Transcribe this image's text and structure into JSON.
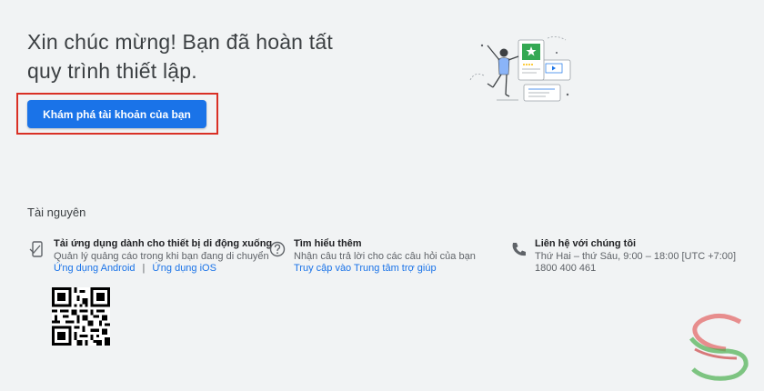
{
  "header": {
    "headline": "Xin chúc mừng! Bạn đã hoàn tất quy trình thiết lập.",
    "explore_button": "Khám phá tài khoản của bạn"
  },
  "resources": {
    "title": "Tài nguyên",
    "mobile": {
      "icon": "mobile-phone-icon",
      "title": "Tải ứng dụng dành cho thiết bị di động xuống",
      "description": "Quản lý quảng cáo trong khi bạn đang di chuyển",
      "android_link": "Ứng dụng Android",
      "separator": "|",
      "ios_link": "Ứng dụng iOS"
    },
    "learn": {
      "icon": "help-circle-icon",
      "title": "Tìm hiểu thêm",
      "description": "Nhận câu trả lời cho các câu hỏi của bạn",
      "help_link": "Truy cập vào Trung tâm trợ giúp"
    },
    "contact": {
      "icon": "phone-icon",
      "title": "Liên hệ với chúng tôi",
      "hours": "Thứ Hai – thứ Sáu, 9:00 – 18:00 [UTC +7:00]",
      "phone": "1800 400 461"
    }
  },
  "colors": {
    "background": "#f1f3f4",
    "primary": "#1a73e8",
    "highlight": "#d93025",
    "accent_green": "#34a853"
  }
}
